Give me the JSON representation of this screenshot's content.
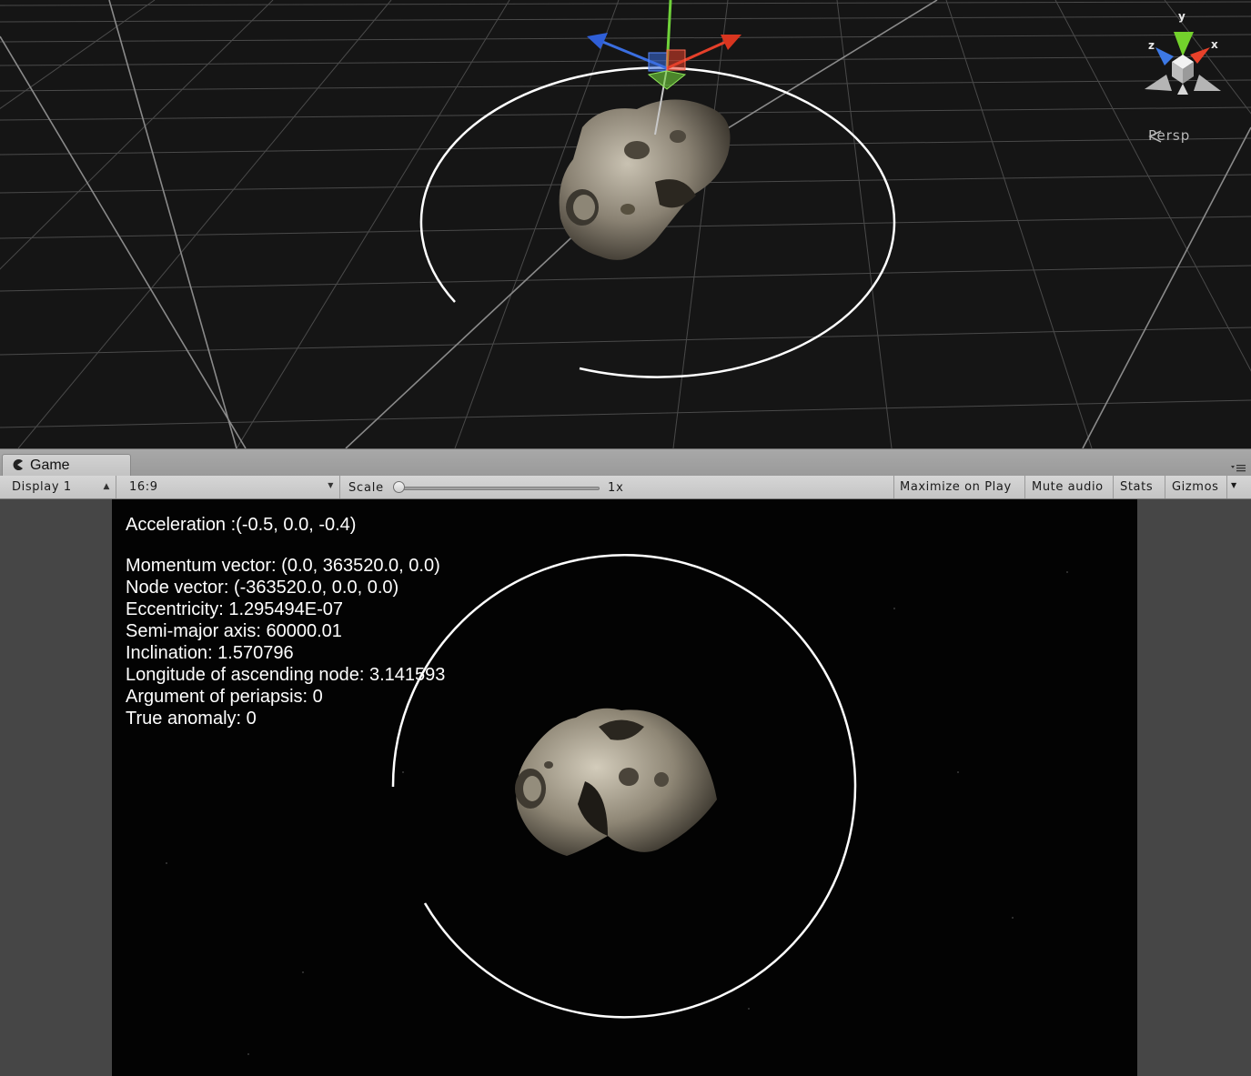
{
  "scene_view": {
    "camera_mode": "Persp",
    "gizmo_axes": {
      "y": "y",
      "x": "x",
      "z": "z"
    },
    "colors": {
      "x_axis": "#e5402a",
      "y_axis": "#6fd13a",
      "z_axis": "#3a6ee0",
      "grid": "#5a5a5a",
      "orbit": "#ffffff",
      "background": "#151515"
    }
  },
  "game_panel": {
    "tab": {
      "label": "Game",
      "icon": "pacman-icon"
    },
    "toolbar": {
      "display": "Display 1",
      "aspect": "16:9",
      "scale_label": "Scale",
      "scale_value": "1x",
      "scale_fraction": 0.0,
      "maximize_on_play": "Maximize on Play",
      "mute_audio": "Mute audio",
      "stats": "Stats",
      "gizmos": "Gizmos"
    }
  },
  "game_view": {
    "hud": {
      "acceleration": "Acceleration :(-0.5, 0.0, -0.4)",
      "momentum": "Momentum vector: (0.0, 363520.0, 0.0)",
      "node": "Node vector: (-363520.0, 0.0, 0.0)",
      "eccentricity": "Eccentricity: 1.295494E-07",
      "semi_major_axis": "Semi-major axis: 60000.01",
      "inclination": "Inclination: 1.570796",
      "longitude_ascending_node": "Longitude of ascending node: 3.141593",
      "argument_periapsis": "Argument of periapsis: 0",
      "true_anomaly": "True anomaly: 0"
    }
  }
}
